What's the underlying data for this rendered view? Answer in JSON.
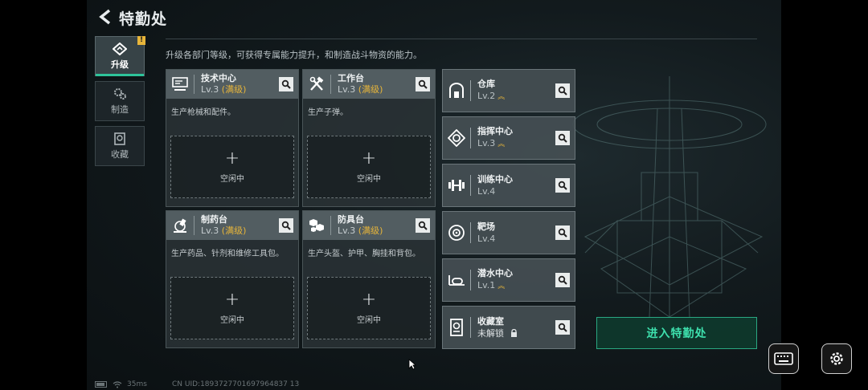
{
  "header": {
    "title": "特勤处"
  },
  "description": "升级各部门等级，可获得专属能力提升，和制造战斗物资的能力。",
  "nav": [
    {
      "label": "升级",
      "icon": "upgrade-icon",
      "badge": "!"
    },
    {
      "label": "制造",
      "icon": "gears-icon"
    },
    {
      "label": "收藏",
      "icon": "collection-icon"
    }
  ],
  "cards": [
    {
      "name": "技术中心",
      "level": "Lv.3",
      "max": "(满级)",
      "desc": "生产枪械和配件。",
      "slot": "空闲中",
      "icon": "tech-center-icon"
    },
    {
      "name": "工作台",
      "level": "Lv.3",
      "max": "(满级)",
      "desc": "生产子弹。",
      "slot": "空闲中",
      "icon": "workbench-icon"
    },
    {
      "name": "制药台",
      "level": "Lv.3",
      "max": "(满级)",
      "desc": "生产药品、针剂和维修工具包。",
      "slot": "空闲中",
      "icon": "pharmacy-icon"
    },
    {
      "name": "防具台",
      "level": "Lv.3",
      "max": "(满级)",
      "desc": "生产头盔、护甲、胸挂和背包。",
      "slot": "空闲中",
      "icon": "armor-bench-icon"
    }
  ],
  "departments": [
    {
      "name": "仓库",
      "level": "Lv.2",
      "upgradable": true,
      "icon": "warehouse-icon"
    },
    {
      "name": "指挥中心",
      "level": "Lv.3",
      "upgradable": true,
      "icon": "command-center-icon"
    },
    {
      "name": "训练中心",
      "level": "Lv.4",
      "upgradable": false,
      "icon": "dumbbell-icon"
    },
    {
      "name": "靶场",
      "level": "Lv.4",
      "upgradable": false,
      "icon": "target-icon"
    },
    {
      "name": "潜水中心",
      "level": "Lv.1",
      "upgradable": true,
      "icon": "diving-icon"
    },
    {
      "name": "收藏室",
      "level": "未解锁",
      "locked": true,
      "icon": "collection-room-icon"
    }
  ],
  "enter_button": "进入特勤处",
  "status": {
    "ping": "35ms",
    "uid": "CN UID:1893727701697964837 13"
  },
  "colors": {
    "accent_green": "#3ee0ad",
    "max_yellow": "#e7b53a"
  }
}
